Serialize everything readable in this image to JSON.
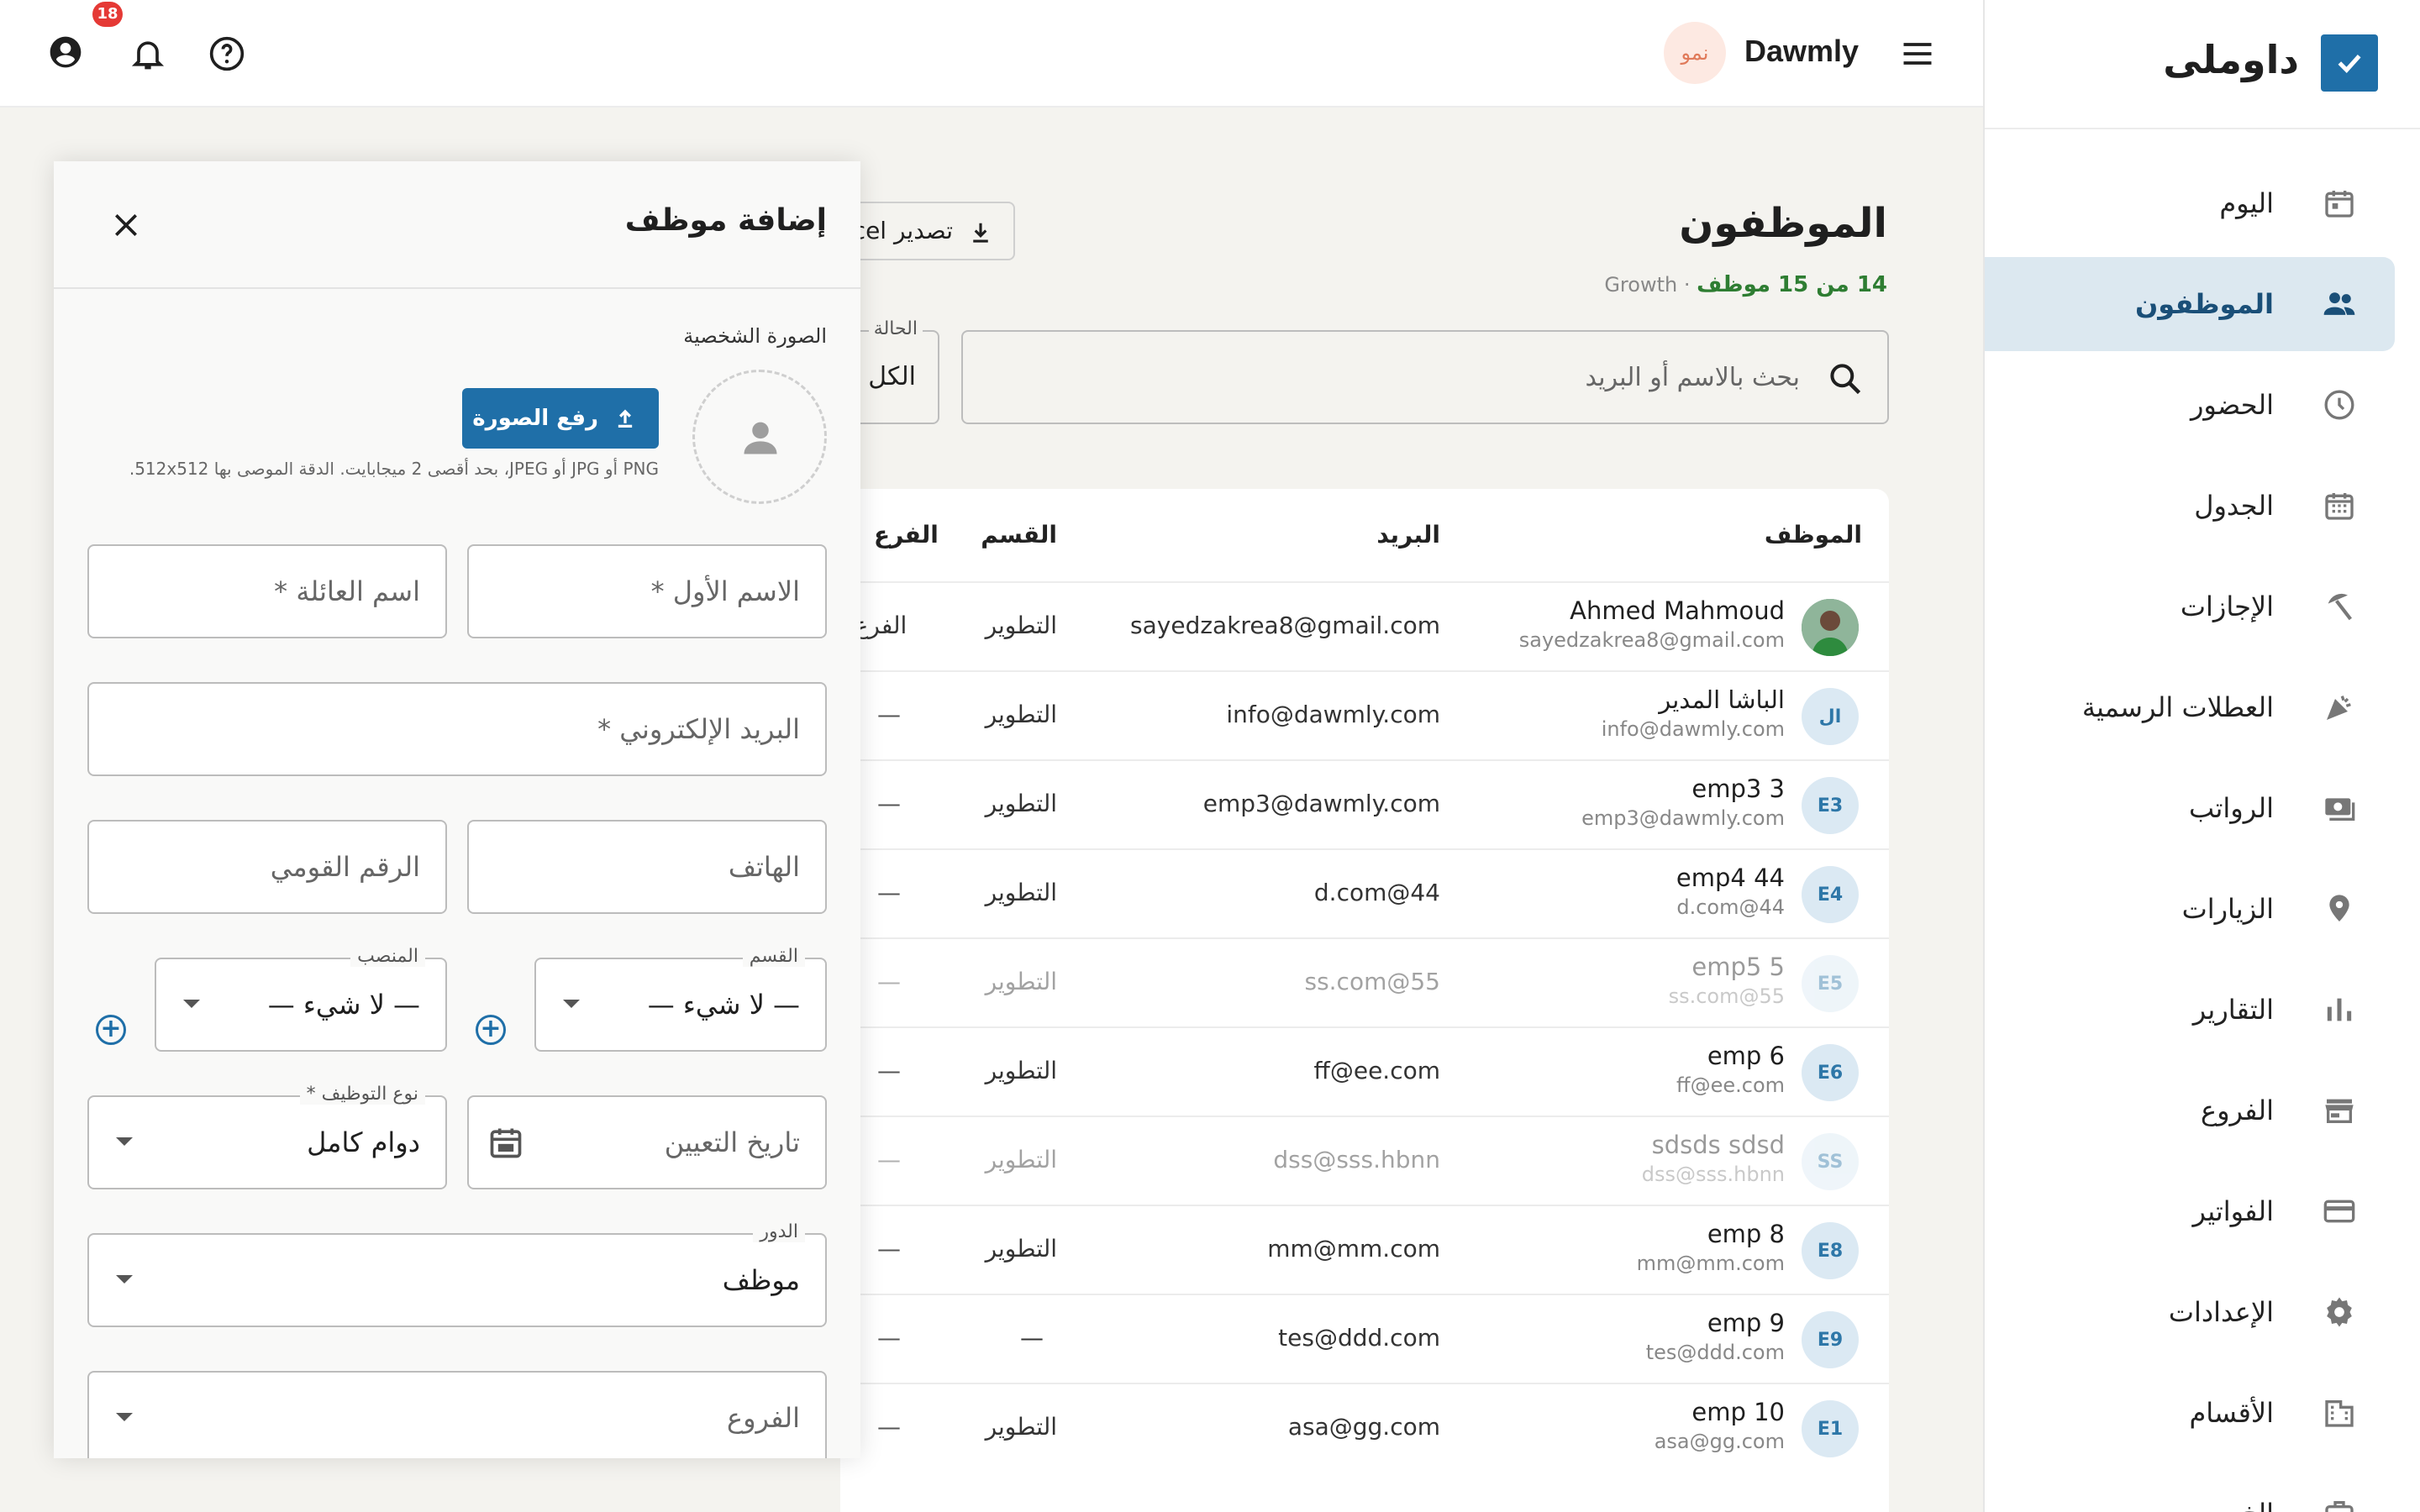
{
  "app": {
    "brand_ar": "داوملى",
    "brand_en": "Dawmly",
    "org_badge": "نمو",
    "notifications_count": "18"
  },
  "sidebar": {
    "items": [
      {
        "label": "اليوم"
      },
      {
        "label": "الموظفون"
      },
      {
        "label": "الحضور"
      },
      {
        "label": "الجدول"
      },
      {
        "label": "الإجازات"
      },
      {
        "label": "العطلات الرسمية"
      },
      {
        "label": "الرواتب"
      },
      {
        "label": "الزيارات"
      },
      {
        "label": "التقارير"
      },
      {
        "label": "الفروع"
      },
      {
        "label": "الفواتير"
      },
      {
        "label": "الإعدادات"
      },
      {
        "label": "الأقسام"
      },
      {
        "label": "الخ"
      }
    ]
  },
  "main": {
    "title": "الموظفون",
    "count": "14 من 15 موظف",
    "plan": "Growth",
    "export_label": "تصدير Excel",
    "search_placeholder": "بحث بالاسم أو البريد",
    "status_label": "الحالة",
    "status_value": "الكل",
    "columns": {
      "employee": "الموظف",
      "email": "البريد",
      "department": "القسم",
      "branch": "الفرع"
    },
    "rows": [
      {
        "initials": "",
        "name": "Ahmed Mahmoud",
        "sub": "sayedzakrea8@gmail.com",
        "email": "sayedzakrea8@gmail.com",
        "dept": "التطوير",
        "branch": "الفرع ا"
      },
      {
        "initials": "ال",
        "name": "الباشا المدير",
        "sub": "info@dawmly.com",
        "email": "info@dawmly.com",
        "dept": "التطوير",
        "branch": "—"
      },
      {
        "initials": "E3",
        "name": "emp3 3",
        "sub": "emp3@dawmly.com",
        "email": "emp3@dawmly.com",
        "dept": "التطوير",
        "branch": "—"
      },
      {
        "initials": "E4",
        "name": "emp4 44",
        "sub": "d.com@44",
        "email": "d.com@44",
        "dept": "التطوير",
        "branch": "—"
      },
      {
        "initials": "E5",
        "name": "emp5 5",
        "sub": "ss.com@55",
        "email": "ss.com@55",
        "dept": "التطوير",
        "branch": "—"
      },
      {
        "initials": "E6",
        "name": "emp 6",
        "sub": "ff@ee.com",
        "email": "ff@ee.com",
        "dept": "التطوير",
        "branch": "—"
      },
      {
        "initials": "SS",
        "name": "sdsds sdsd",
        "sub": "dss@sss.hbnn",
        "email": "dss@sss.hbnn",
        "dept": "التطوير",
        "branch": "—"
      },
      {
        "initials": "E8",
        "name": "emp 8",
        "sub": "mm@mm.com",
        "email": "mm@mm.com",
        "dept": "التطوير",
        "branch": "—"
      },
      {
        "initials": "E9",
        "name": "emp 9",
        "sub": "tes@ddd.com",
        "email": "tes@ddd.com",
        "dept": "—",
        "branch": "—"
      },
      {
        "initials": "E1",
        "name": "emp 10",
        "sub": "asa@gg.com",
        "email": "asa@gg.com",
        "dept": "التطوير",
        "branch": "—"
      }
    ]
  },
  "drawer": {
    "title": "إضافة موظف",
    "photo_label": "الصورة الشخصية",
    "upload_label": "رفع الصورة",
    "upload_hint": "PNG أو JPG أو JPEG، بحد أقصى 2 ميجابايت. الدقة الموصى بها 512x512.",
    "first_name": "الاسم الأول *",
    "last_name": "اسم العائلة *",
    "email": "البريد الإلكتروني *",
    "phone": "الهاتف",
    "national_id": "الرقم القومي",
    "department_label": "القسم",
    "department_value": "— لا شيء —",
    "position_label": "المنصب",
    "position_value": "— لا شيء —",
    "hire_date": "تاريخ التعيين",
    "employment_type_label": "نوع التوظيف *",
    "employment_type_value": "دوام كامل",
    "role_label": "الدور",
    "role_value": "موظف",
    "branches": "الفروع"
  },
  "colors": {
    "accent": "#1f6fa8",
    "active_bg": "#dce8f0",
    "green": "#2e7d32",
    "badge": "#e53935"
  }
}
